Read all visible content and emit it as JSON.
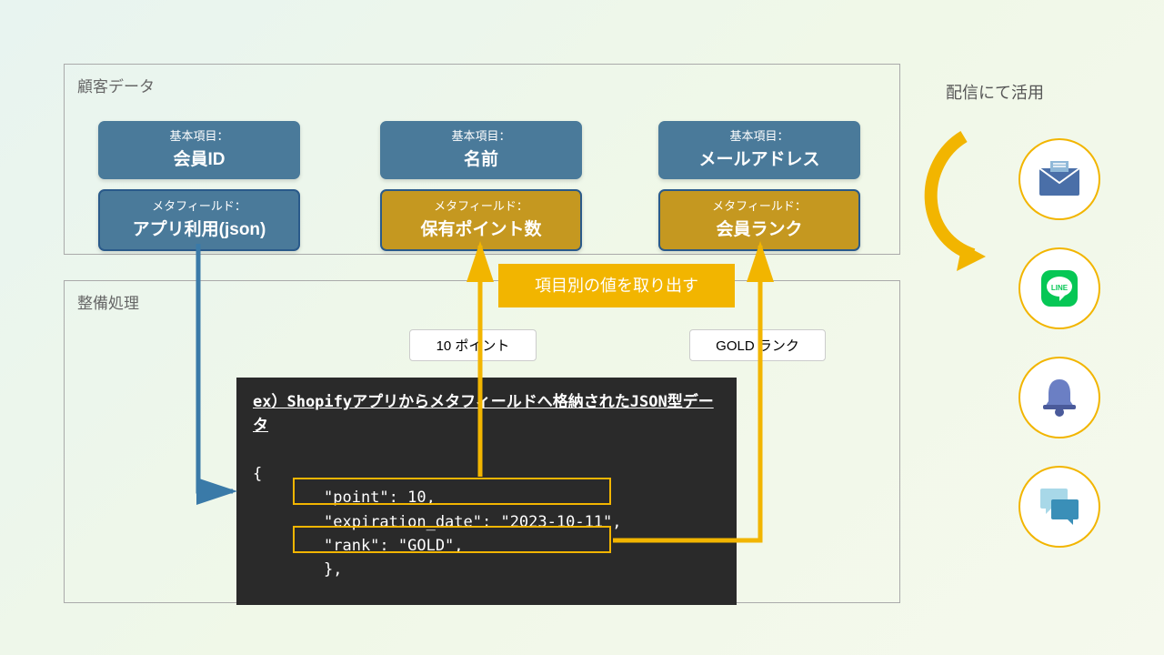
{
  "customer_panel": {
    "title": "顧客データ",
    "basic_label": "基本項目：",
    "meta_label": "メタフィールド：",
    "basic1": "会員ID",
    "basic2": "名前",
    "basic3": "メールアドレス",
    "meta1": "アプリ利用(json)",
    "meta2": "保有ポイント数",
    "meta3": "会員ランク"
  },
  "process_panel": {
    "title": "整備処理"
  },
  "extract_label": "項目別の値を取り出す",
  "values": {
    "points": "10 ポイント",
    "rank": "GOLD ランク"
  },
  "code": {
    "title": "ex）Shopifyアプリからメタフィールドへ格納されたJSON型データ",
    "open": "{",
    "l1": "\"point\": 10,",
    "l2": "\"expiration_date\": \"2023-10-11\",",
    "l3": "\"rank\": \"GOLD\",",
    "close": "},"
  },
  "right": {
    "title": "配信にて活用"
  },
  "icons": {
    "mail": "mail-icon",
    "line": "line-icon",
    "bell": "bell-icon",
    "chat": "chat-icon"
  }
}
